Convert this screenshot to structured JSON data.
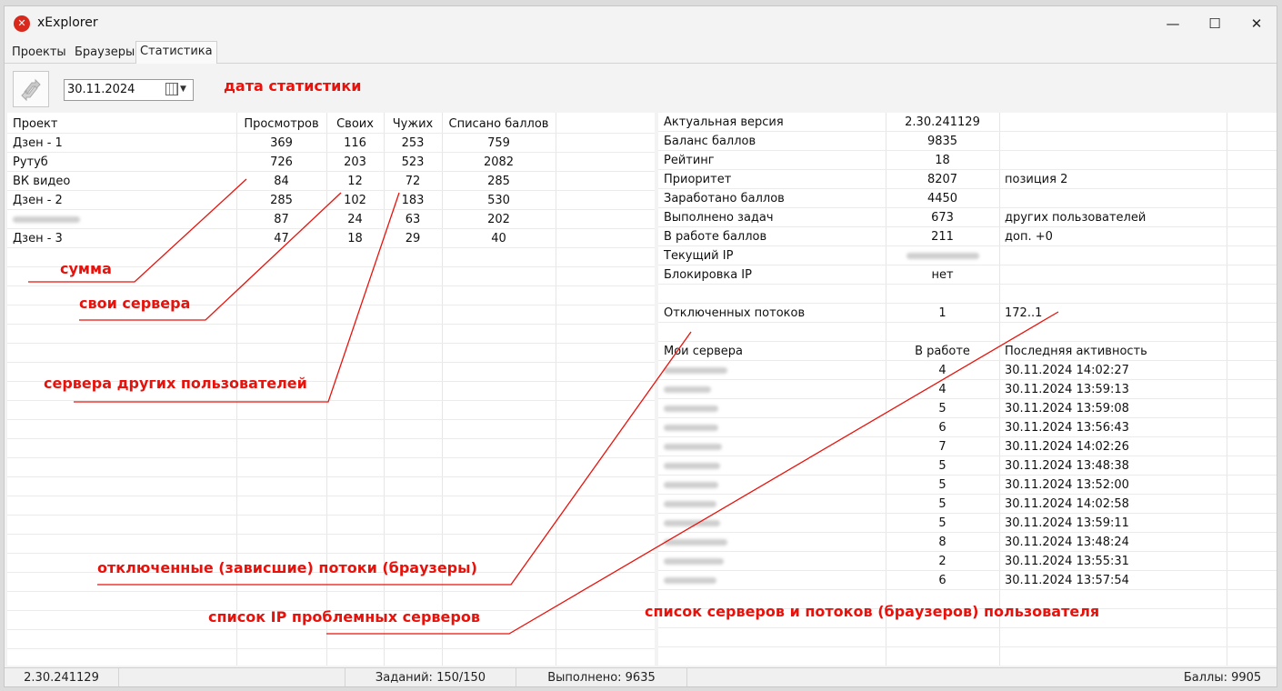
{
  "window": {
    "title": "xExplorer",
    "close_glyph": "✕",
    "max_glyph": "☐",
    "min_glyph": "—"
  },
  "tabs": [
    {
      "label": "Проекты"
    },
    {
      "label": "Браузеры"
    },
    {
      "label": "Статистика"
    }
  ],
  "toolbar": {
    "date": "30.11.2024"
  },
  "annotations": {
    "date": "дата статистики",
    "sum": "сумма",
    "own_servers": "свои сервера",
    "other_servers": "сервера других пользователей",
    "disconnected": "отключенные (зависшие) потоки (браузеры)",
    "problem_ips": "список IP проблемных серверов",
    "user_servers": "список серверов и потоков (браузеров) пользователя"
  },
  "projects_table": {
    "headers": [
      "Проект",
      "Просмотров",
      "Своих",
      "Чужих",
      "Списано баллов"
    ],
    "rows": [
      {
        "name": "Дзен - 1",
        "views": "369",
        "own": "116",
        "other": "253",
        "spent": "759"
      },
      {
        "name": "Рутуб",
        "views": "726",
        "own": "203",
        "other": "523",
        "spent": "2082"
      },
      {
        "name": "ВК видео",
        "views": "84",
        "own": "12",
        "other": "72",
        "spent": "285"
      },
      {
        "name": "Дзен - 2",
        "views": "285",
        "own": "102",
        "other": "183",
        "spent": "530"
      },
      {
        "name": "",
        "views": "87",
        "own": "24",
        "other": "63",
        "spent": "202"
      },
      {
        "name": "Дзен - 3",
        "views": "47",
        "own": "18",
        "other": "29",
        "spent": "40"
      }
    ]
  },
  "stats": [
    {
      "label": "Актуальная версия",
      "value": "2.30.241129",
      "note": ""
    },
    {
      "label": "Баланс баллов",
      "value": "9835",
      "note": ""
    },
    {
      "label": "Рейтинг",
      "value": "18",
      "note": ""
    },
    {
      "label": "Приоритет",
      "value": "8207",
      "note": "позиция 2"
    },
    {
      "label": "Заработано баллов",
      "value": "4450",
      "note": ""
    },
    {
      "label": "Выполнено задач",
      "value": "673",
      "note": "других пользователей"
    },
    {
      "label": "В работе баллов",
      "value": "211",
      "note": "доп. +0"
    },
    {
      "label": "Текущий IP",
      "value": "",
      "note": ""
    },
    {
      "label": "Блокировка IP",
      "value": "нет",
      "note": ""
    },
    {
      "label": "",
      "value": "",
      "note": ""
    },
    {
      "label": "Отключенных потоков",
      "value": "1",
      "note": "172..1"
    },
    {
      "label": "",
      "value": "",
      "note": ""
    },
    {
      "label": "Мои сервера",
      "value": "В работе",
      "note": "Последняя активность"
    }
  ],
  "servers": [
    {
      "ip": "",
      "work": "4",
      "last": "30.11.2024 14:02:27"
    },
    {
      "ip": "",
      "work": "4",
      "last": "30.11.2024 13:59:13"
    },
    {
      "ip": "",
      "work": "5",
      "last": "30.11.2024 13:59:08"
    },
    {
      "ip": "",
      "work": "6",
      "last": "30.11.2024 13:56:43"
    },
    {
      "ip": "",
      "work": "7",
      "last": "30.11.2024 14:02:26"
    },
    {
      "ip": "",
      "work": "5",
      "last": "30.11.2024 13:48:38"
    },
    {
      "ip": "",
      "work": "5",
      "last": "30.11.2024 13:52:00"
    },
    {
      "ip": "",
      "work": "5",
      "last": "30.11.2024 14:02:58"
    },
    {
      "ip": "",
      "work": "5",
      "last": "30.11.2024 13:59:11"
    },
    {
      "ip": "",
      "work": "8",
      "last": "30.11.2024 13:48:24"
    },
    {
      "ip": "",
      "work": "2",
      "last": "30.11.2024 13:55:31"
    },
    {
      "ip": "",
      "work": "6",
      "last": "30.11.2024 13:57:54"
    }
  ],
  "statusbar": {
    "version": "2.30.241129",
    "tasks": "Заданий: 150/150",
    "done": "Выполнено: 9635",
    "balance": "Баллы: 9905"
  },
  "colors": {
    "annotation": "#e8120c",
    "app_icon": "#d9281c"
  }
}
